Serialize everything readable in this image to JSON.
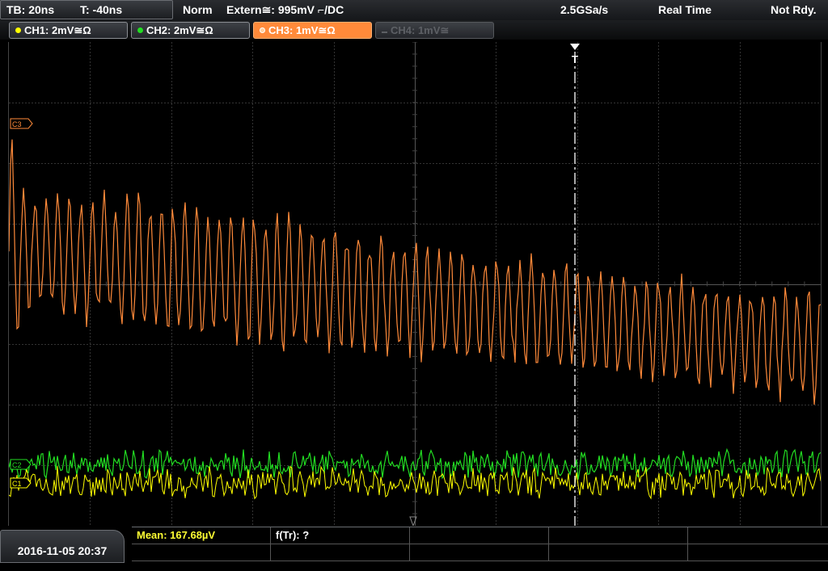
{
  "header": {
    "timebase": "TB: 20ns",
    "trigger_time": "T: -40ns",
    "mode": "Norm",
    "trigger_source": "Extern≅: 995mV ⌐/DC",
    "sample_rate": "2.5GSa/s",
    "acq_mode": "Real Time",
    "status": "Not Rdy."
  },
  "channels": [
    {
      "label": "CH1: 2mV≅Ω",
      "color": "#ffff00",
      "state": "on"
    },
    {
      "label": "CH2: 2mV≅Ω",
      "color": "#22dd22",
      "state": "on"
    },
    {
      "label": "CH3: 1mV≅Ω",
      "color": "#ff8a3a",
      "state": "selected"
    },
    {
      "label": "CH4: 1mV≅",
      "color": "#5d6065",
      "state": "off"
    }
  ],
  "markers": {
    "ch3": "C3",
    "ch2": "C2",
    "ch1": "C1",
    "trigger": "T"
  },
  "footer": {
    "datetime": "2016-11-05 20:37",
    "mean": "Mean: 167.68µV",
    "freq": "f(Tr): ?"
  },
  "colors": {
    "ch1": "#ffff00",
    "ch2": "#22dd22",
    "ch3": "#ff8a3a",
    "grid": "#3a3a3a",
    "mean_text": "#ffff33"
  }
}
